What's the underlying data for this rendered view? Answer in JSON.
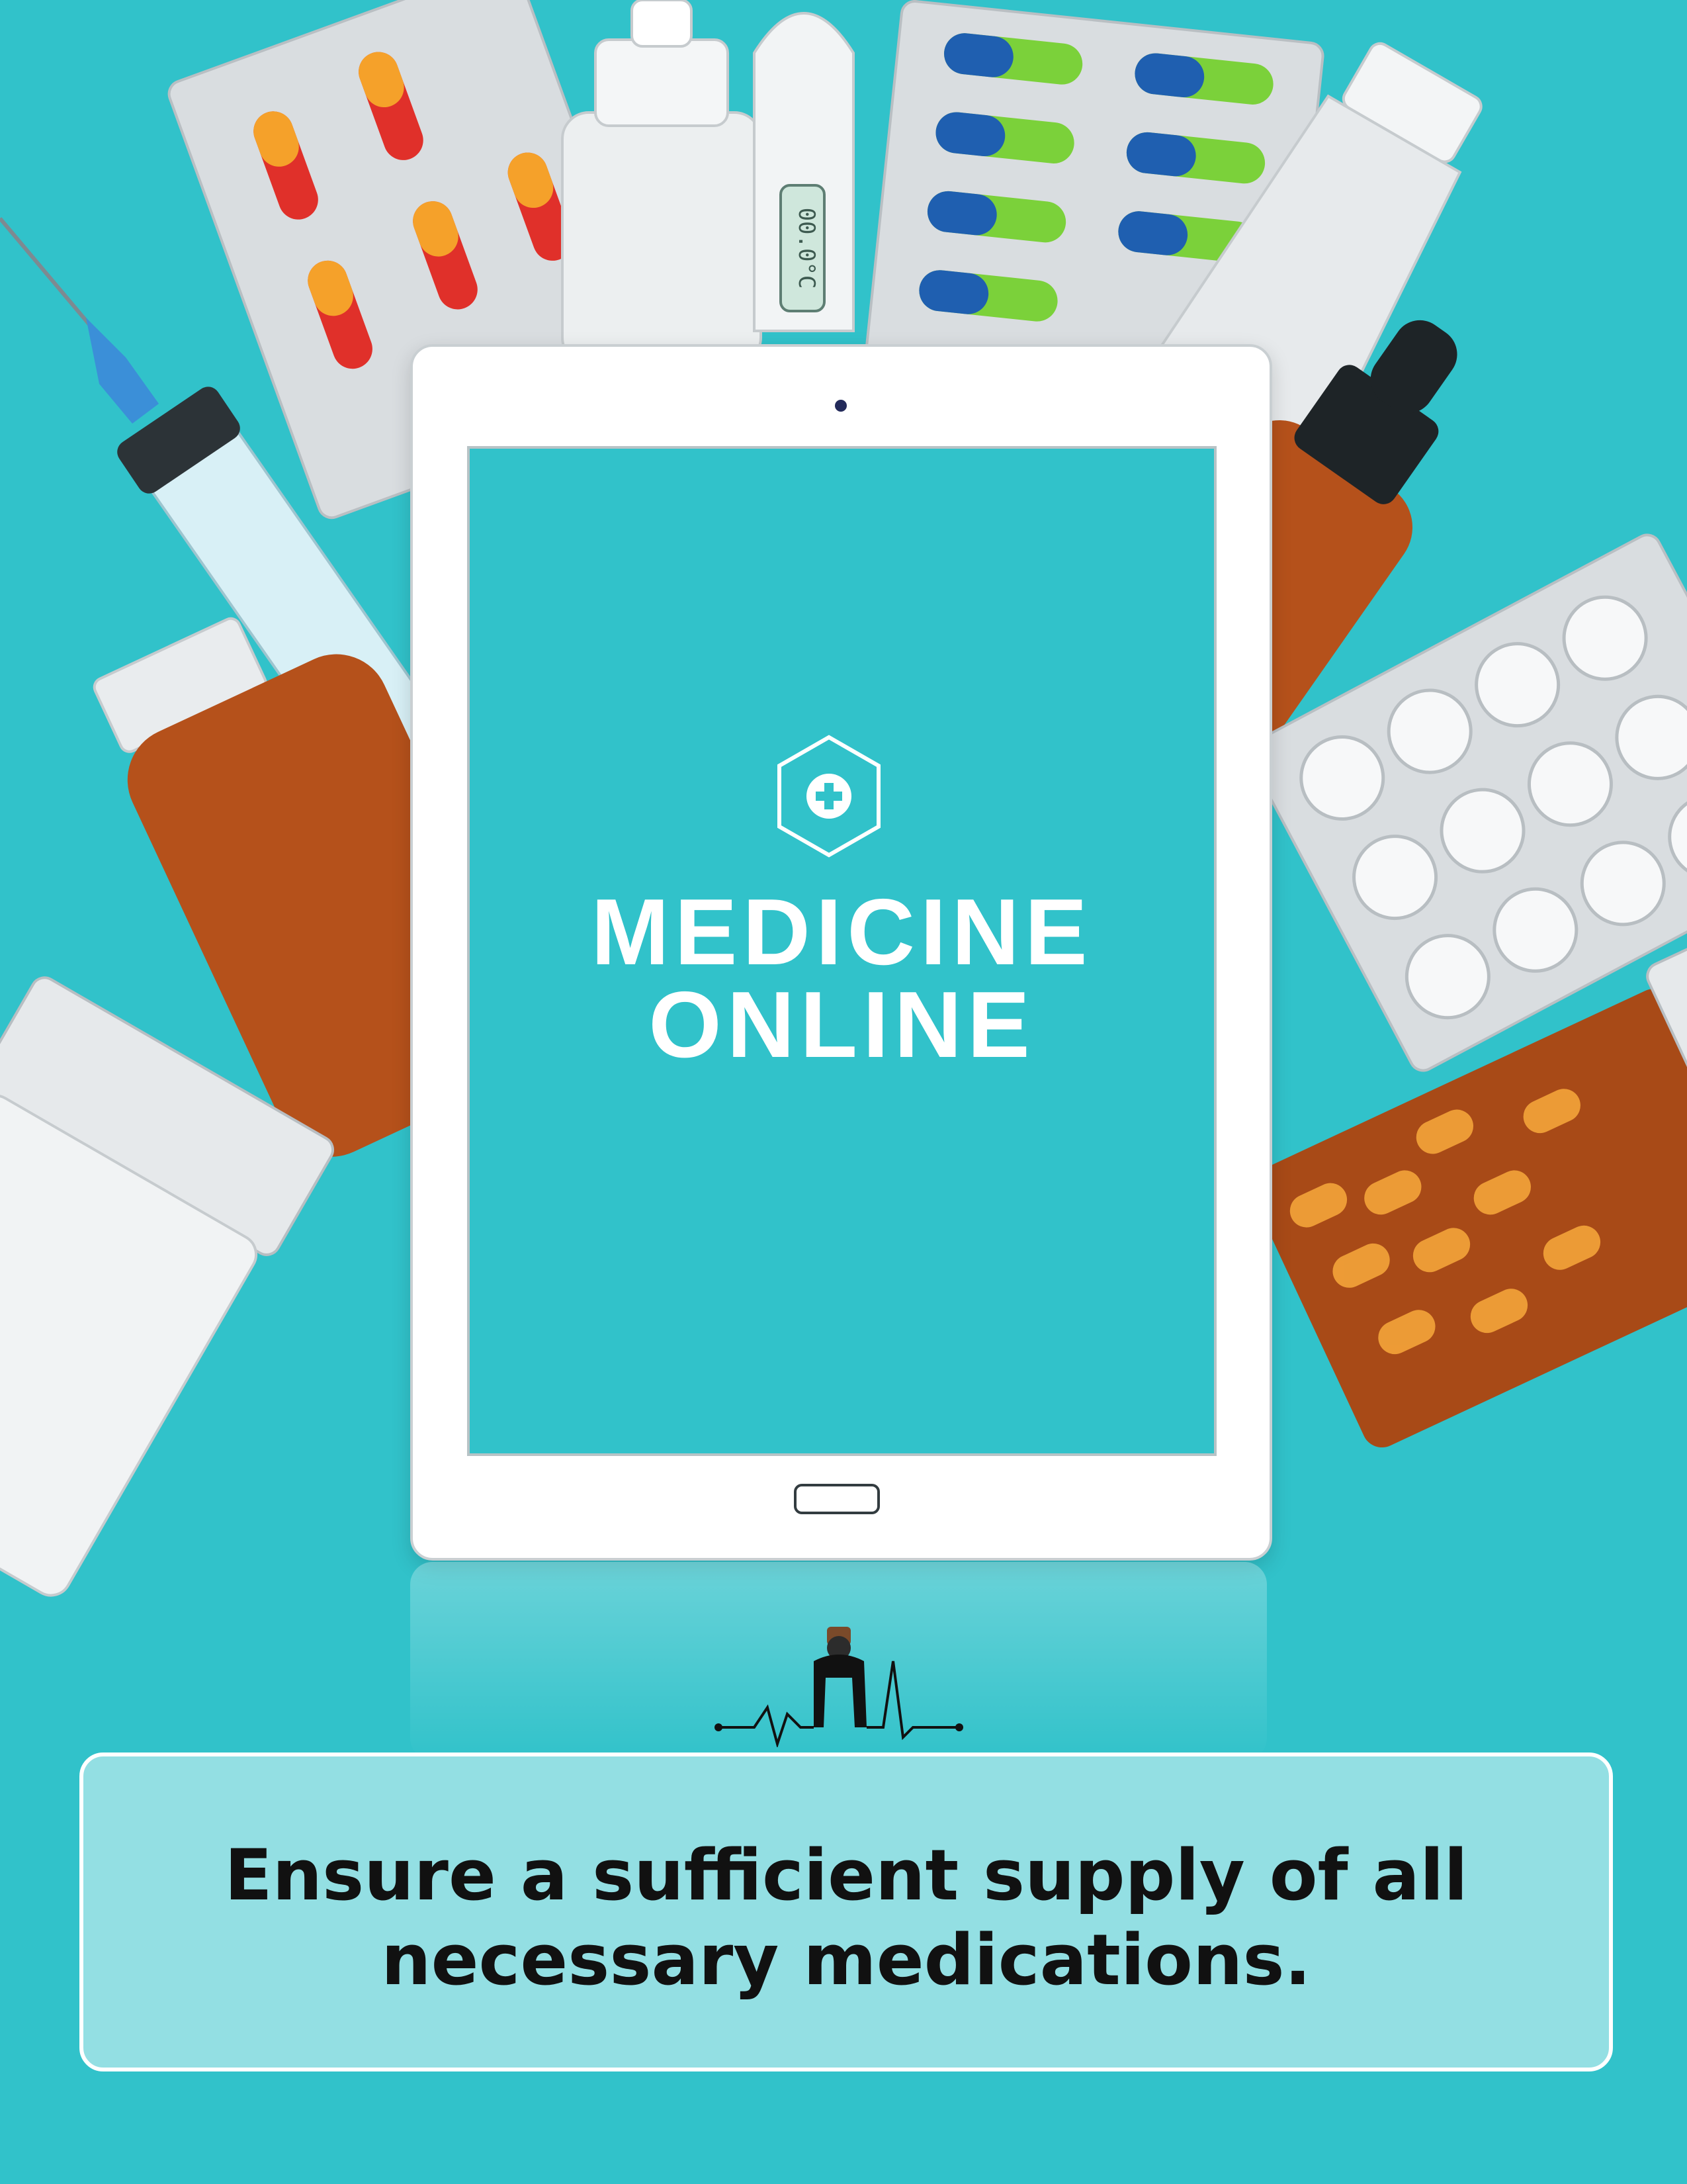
{
  "colors": {
    "background": "#31c2ca",
    "tablet": "#ffffff",
    "screen": "#31c2ca",
    "caption_box": "#93dfe3",
    "caption_text": "#111111"
  },
  "tablet_screen": {
    "logo_icon": "medical-cross-hexagon-icon",
    "title_line_1": "MEDICINE",
    "title_line_2": "ONLINE"
  },
  "thermometer": {
    "reading": "00.0°C"
  },
  "footer": {
    "icon": "heartbeat-doctor-icon",
    "caption_line_1": "Ensure a sufficient supply of all",
    "caption_line_2": "necessary medications."
  },
  "decorations": [
    "capsule-blister-pack-orange-red",
    "dropper-bottle-white",
    "thermometer",
    "capsule-blister-pack-blue-green",
    "ointment-tube",
    "syringe",
    "amber-dropper-bottle",
    "amber-medicine-bottle",
    "tablet-blister-pack",
    "white-pill-bottle",
    "amber-pill-bottle"
  ]
}
